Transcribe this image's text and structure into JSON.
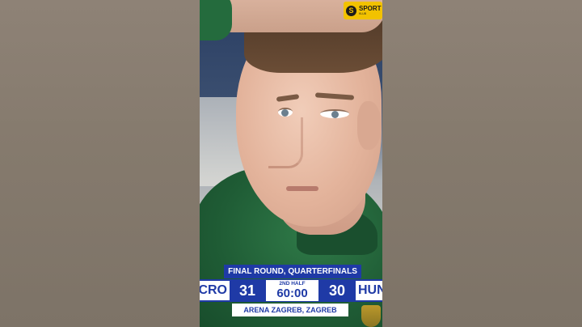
{
  "logo": {
    "mark": "S",
    "word": "SPORT",
    "sub": "KLUB"
  },
  "scoreboard": {
    "round": "FINAL ROUND, QUARTERFINALS",
    "home_team": "CRO",
    "home_score": "31",
    "period": "2ND HALF",
    "clock": "60:00",
    "away_score": "30",
    "away_team": "HUN",
    "venue": "ARENA ZAGREB, ZAGREB"
  },
  "colors": {
    "scoreboard_blue": "#1f3aa6",
    "logo_yellow": "#f2c200",
    "jacket_green": "#1f5c35"
  }
}
